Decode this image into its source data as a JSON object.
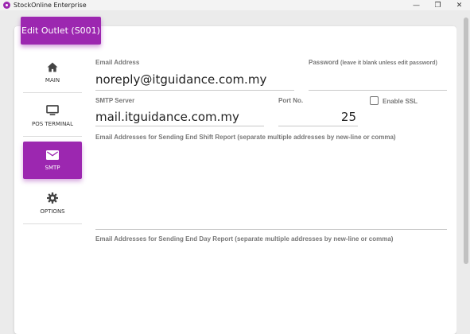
{
  "window": {
    "title": "StockOnline Enterprise",
    "controls": {
      "minimize": "—",
      "maximize": "❐",
      "close": "✕"
    }
  },
  "header": {
    "title": "Edit Outlet (S001)"
  },
  "nav": {
    "items": [
      {
        "label": "MAIN",
        "icon": "home-icon"
      },
      {
        "label": "POS TERMINAL",
        "icon": "monitor-icon"
      },
      {
        "label": "SMTP",
        "icon": "mail-icon",
        "active": true
      },
      {
        "label": "OPTIONS",
        "icon": "gear-icon"
      }
    ]
  },
  "form": {
    "email_label": "Email Address",
    "email_value": "noreply@itguidance.com.my",
    "password_label": "Password",
    "password_hint": "(leave it blank unless edit password)",
    "password_value": "",
    "smtp_label": "SMTP Server",
    "smtp_value": "mail.itguidance.com.my",
    "port_label": "Port No.",
    "port_value": "25",
    "ssl_label": "Enable SSL",
    "ssl_checked": false,
    "shift_report_label": "Email Addresses for Sending End Shift Report (separate multiple addresses by new-line or comma)",
    "shift_report_value": "",
    "day_report_label": "Email Addresses for Sending End Day Report (separate multiple addresses by new-line or comma)",
    "day_report_value": ""
  },
  "colors": {
    "accent": "#9c27b0"
  }
}
